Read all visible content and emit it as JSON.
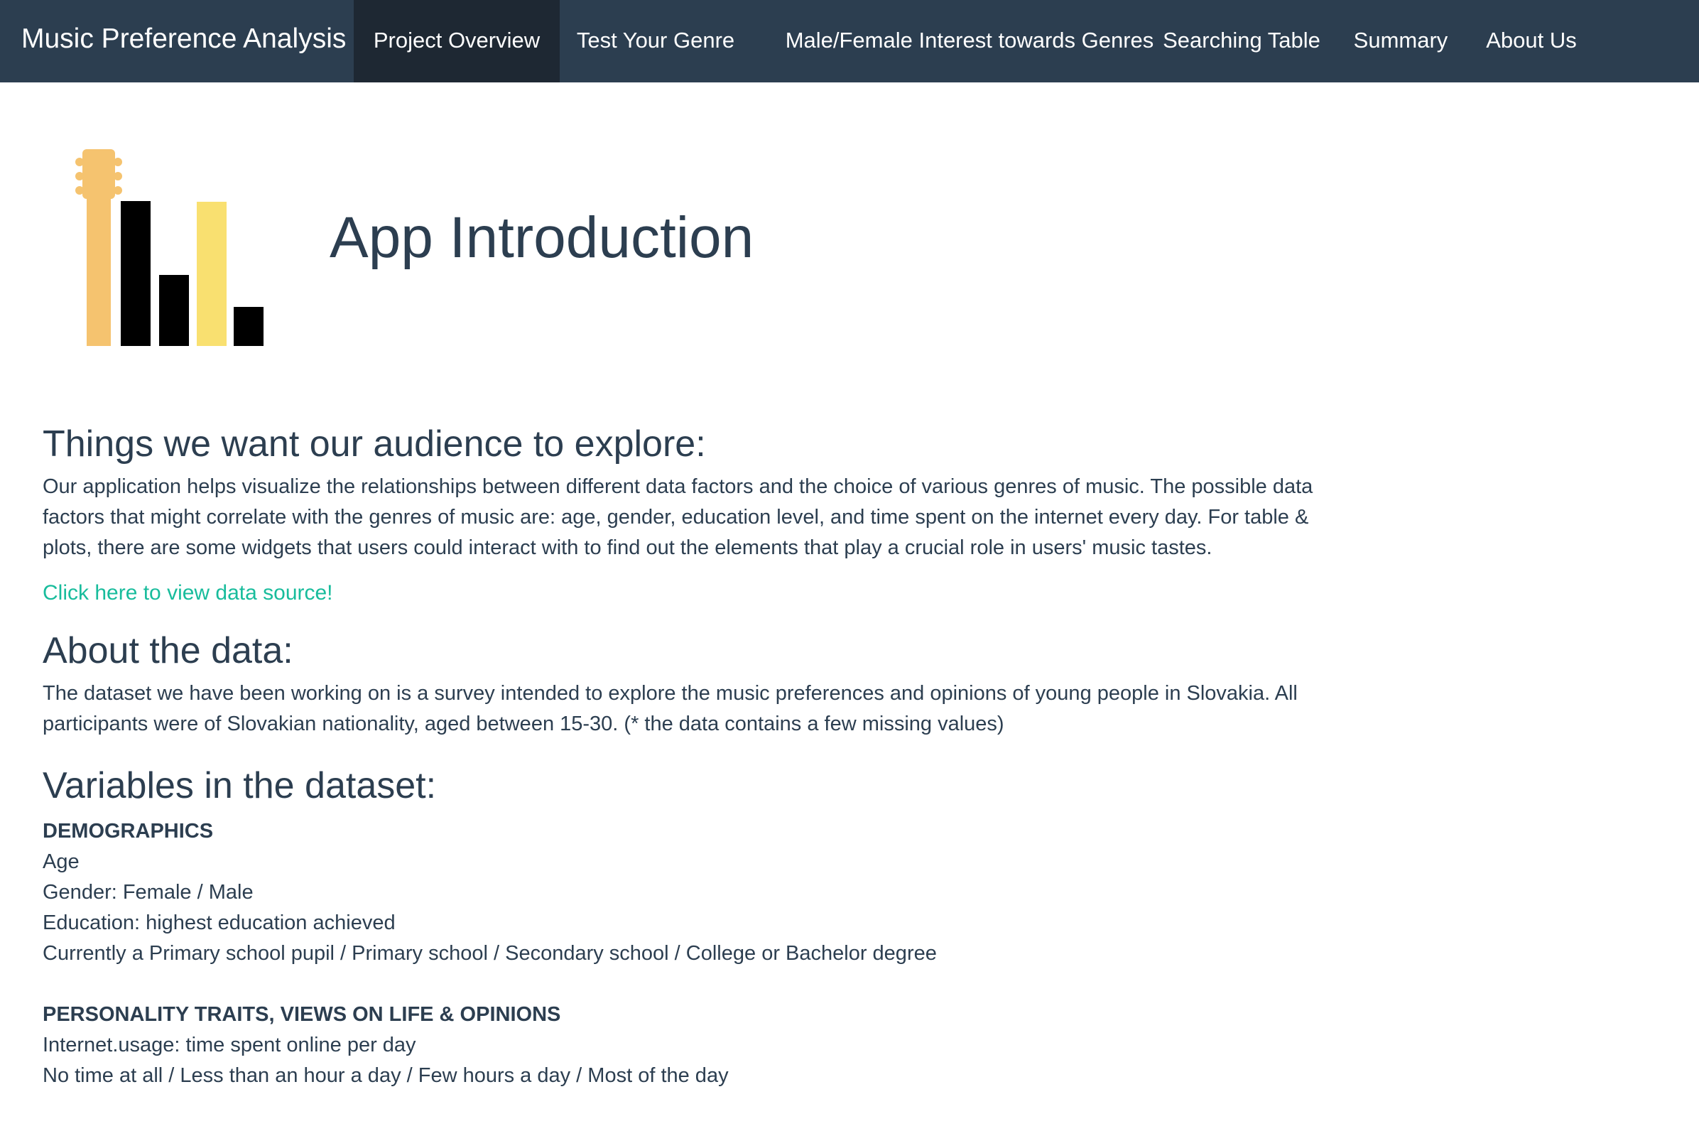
{
  "navbar": {
    "brand": "Music Preference Analysis",
    "items": [
      {
        "label": "Project Overview",
        "active": true
      },
      {
        "label": "Test Your Genre"
      },
      {
        "label": "Male/Female Interest towards Genres"
      },
      {
        "label": "Searching Table"
      },
      {
        "label": "Summary"
      },
      {
        "label": "About Us"
      }
    ]
  },
  "colors": {
    "navbar_bg": "#2c3e50",
    "navbar_active_bg": "#1e2833",
    "link": "#18bc9c",
    "logo_guitar": "#f5c36f",
    "logo_yellow_bar": "#f9e070",
    "logo_black_bar": "#000000"
  },
  "main": {
    "title": "App Introduction",
    "explore": {
      "heading": "Things we want our audience to explore:",
      "text": "Our application helps visualize the relationships between different data factors and the choice of various genres of music. The possible data factors that might correlate with the genres of music are: age, gender, education level, and time spent on the internet every day. For table & plots, there are some widgets that users could interact with to find out the elements that play a crucial role in users' music tastes.",
      "link": "Click here to view data source!"
    },
    "about": {
      "heading": "About the data:",
      "text": "The dataset we have been working on is a survey intended to explore the music preferences and opinions of young people in Slovakia. All participants were of Slovakian nationality, aged between 15-30. (* the data contains a few missing values)"
    },
    "variables": {
      "heading": "Variables in the dataset:",
      "demographics": {
        "title": "DEMOGRAPHICS",
        "lines": [
          "Age",
          "Gender: Female / Male",
          "Education: highest education achieved",
          "Currently a Primary school pupil / Primary school / Secondary school / College or Bachelor degree"
        ]
      },
      "personality": {
        "title": "PERSONALITY TRAITS, VIEWS ON LIFE & OPINIONS",
        "lines": [
          "Internet.usage: time spent online per day",
          "No time at all / Less than an hour a day / Few hours a day / Most of the day"
        ]
      }
    }
  }
}
